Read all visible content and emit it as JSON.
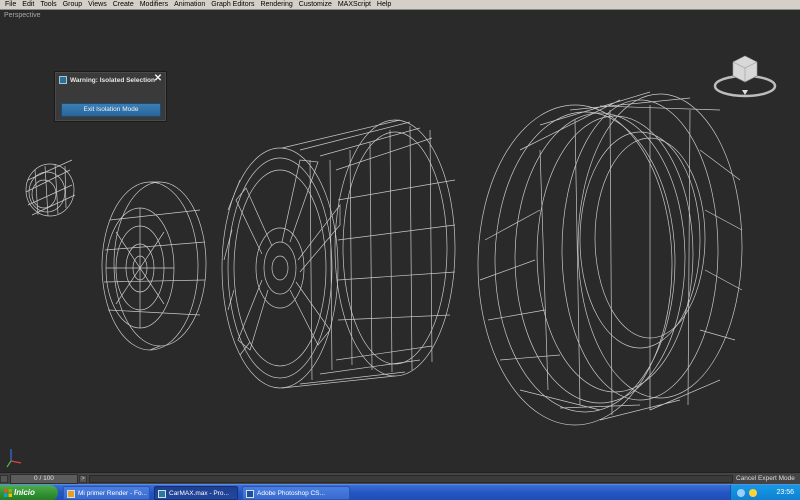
{
  "menubar": {
    "items": [
      "File",
      "Edit",
      "Tools",
      "Group",
      "Views",
      "Create",
      "Modifiers",
      "Animation",
      "Graph Editors",
      "Rendering",
      "Customize",
      "MAXScript",
      "Help"
    ]
  },
  "viewport": {
    "label": "Perspective",
    "background": "#2a2a2a",
    "wire_color": "#c8c8c8"
  },
  "warning_dialog": {
    "title": "Warning: Isolated Selection",
    "button_label": "Exit Isolation Mode",
    "close_glyph": "✕",
    "accent": "#2d6ea5"
  },
  "viewcube": {
    "faces": [
      "TOP",
      "FRONT"
    ]
  },
  "timeline": {
    "frame_counter": "0 / 100",
    "left_arrow": "<",
    "right_arrow": ">"
  },
  "status": {
    "cancel_expert_label": "Cancel Expert Mode"
  },
  "taskbar": {
    "start_label": "Inicio",
    "tasks": [
      {
        "label": "Mi primer Render - Fo...",
        "icon": "browser-icon",
        "active": false
      },
      {
        "label": "CarMAX.max    - Pro...",
        "icon": "3dsmax-icon",
        "active": true
      },
      {
        "label": "Adobe Photoshop CS...",
        "icon": "photoshop-icon",
        "active": false
      }
    ],
    "clock": "23:56"
  }
}
